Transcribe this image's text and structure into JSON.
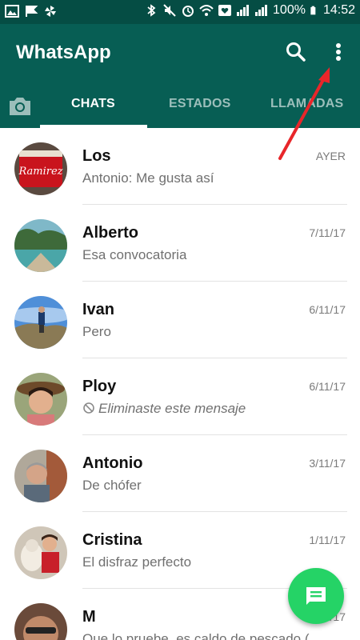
{
  "status_bar": {
    "battery_text": "100%",
    "time": "14:52"
  },
  "app_bar": {
    "title": "WhatsApp"
  },
  "tabs": [
    {
      "label": "CHATS",
      "active": true
    },
    {
      "label": "ESTADOS",
      "active": false
    },
    {
      "label": "LLAMADAS",
      "active": false
    }
  ],
  "chats": [
    {
      "name": "Los",
      "time": "AYER",
      "message": "Antonio: Me gusta así",
      "avatar_label": "Ramirez"
    },
    {
      "name": "Alberto",
      "time": "7/11/17",
      "message": "Esa convocatoria"
    },
    {
      "name": "Ivan",
      "time": "6/11/17",
      "message": "Pero"
    },
    {
      "name": "Ploy",
      "time": "6/11/17",
      "message": "Eliminaste este mensaje",
      "deleted": true
    },
    {
      "name": "Antonio",
      "time": "3/11/17",
      "message": "De chófer"
    },
    {
      "name": "Cristina",
      "time": "1/11/17",
      "message": "El disfraz perfecto"
    },
    {
      "name": "M",
      "time": "2/11/17",
      "message": "Que lo pruebe, es caldo de pescado ("
    }
  ],
  "colors": {
    "header": "#075e54",
    "status_bar": "#054d44",
    "fab": "#25d366",
    "annotation_arrow": "#e8262a"
  },
  "icons": [
    "camera-icon",
    "search-icon",
    "more-vert-icon",
    "new-chat-icon",
    "blocked-icon"
  ]
}
